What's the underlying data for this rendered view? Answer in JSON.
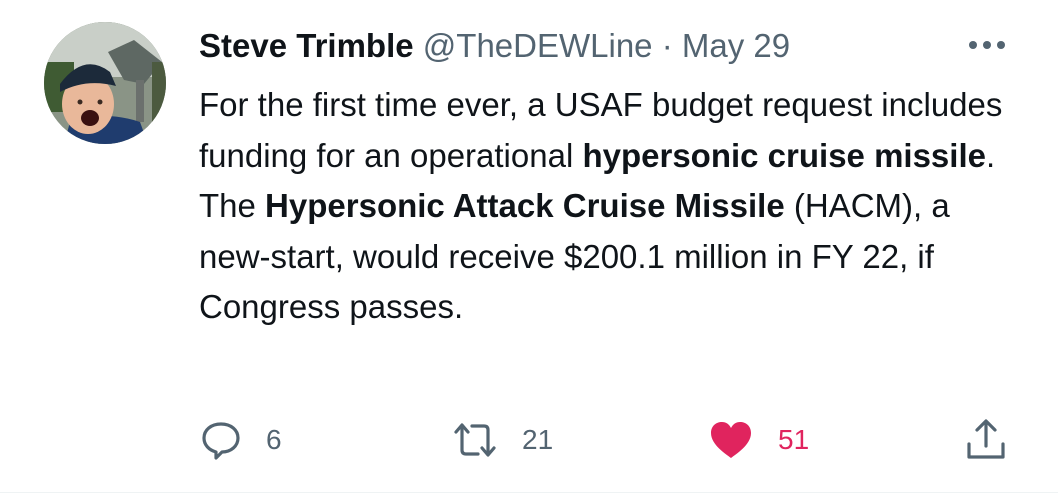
{
  "tweet": {
    "author_name": "Steve Trimble",
    "handle": "@TheDEWLine",
    "separator": "·",
    "date": "May 29",
    "text": {
      "p1": "For the first time ever, a USAF budget request includes funding for an operational ",
      "b1": "hypersonic cruise missile",
      "p2": ". The ",
      "b2": "Hypersonic Attack Cruise Missile",
      "p3": " (HACM), a new-start, would receive $200.1 million in FY 22, if Congress passes."
    },
    "actions": {
      "reply_count": "6",
      "retweet_count": "21",
      "like_count": "51"
    }
  },
  "icons": {
    "reply": "reply-icon",
    "retweet": "retweet-icon",
    "like": "heart-icon",
    "share": "share-icon",
    "more": "more-options-icon"
  },
  "colors": {
    "text": "#0f1419",
    "secondary": "#536471",
    "like": "#e0245e"
  }
}
